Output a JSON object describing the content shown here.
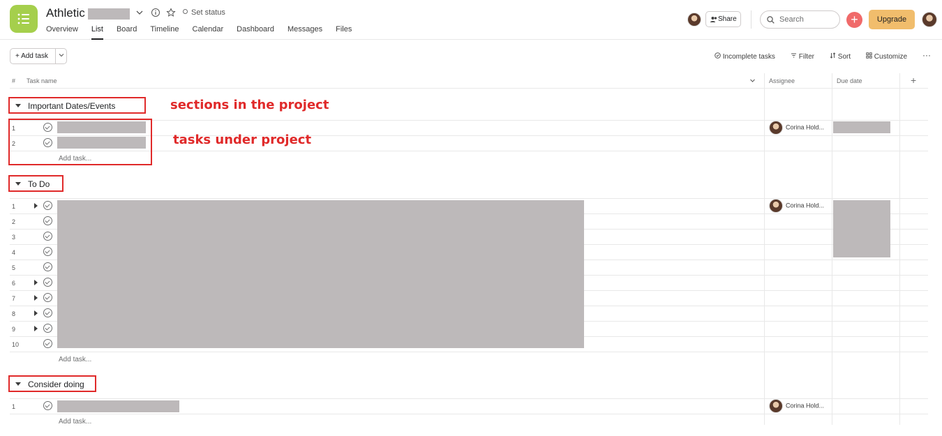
{
  "header": {
    "project_title": "Athletic",
    "set_status": "Set status",
    "tabs": [
      "Overview",
      "List",
      "Board",
      "Timeline",
      "Calendar",
      "Dashboard",
      "Messages",
      "Files"
    ],
    "active_tab": "List",
    "share_label": "Share",
    "search_placeholder": "Search",
    "upgrade_label": "Upgrade",
    "add_icon": "plus-icon"
  },
  "toolbar": {
    "add_task_label": "+ Add task",
    "incomplete_tasks": "Incomplete tasks",
    "filter": "Filter",
    "sort": "Sort",
    "customize": "Customize",
    "more": "···"
  },
  "columns": {
    "num": "#",
    "task_name": "Task name",
    "assignee": "Assignee",
    "due_date": "Due date",
    "add_column": "+"
  },
  "sections": [
    {
      "title": "Important Dates/Events",
      "rows": [
        "1",
        "2"
      ],
      "assignee": "Corina Hold...",
      "add_task": "Add task..."
    },
    {
      "title": "To Do",
      "rows": [
        "1",
        "2",
        "3",
        "4",
        "5",
        "6",
        "7",
        "8",
        "9",
        "10"
      ],
      "assignee": "Corina Hold...",
      "add_task": "Add task..."
    },
    {
      "title": "Consider doing",
      "rows": [
        "1"
      ],
      "assignee": "Corina Hold...",
      "add_task": "Add task..."
    }
  ],
  "annotations": {
    "sections_note": "sections in the project",
    "tasks_note": "tasks under project"
  },
  "colors": {
    "app_icon": "#a5cf4c",
    "upgrade": "#f1bd6c",
    "add_button": "#f06a6a",
    "annotation_red": "#e02a2a",
    "redaction": "#bdb9ba"
  }
}
